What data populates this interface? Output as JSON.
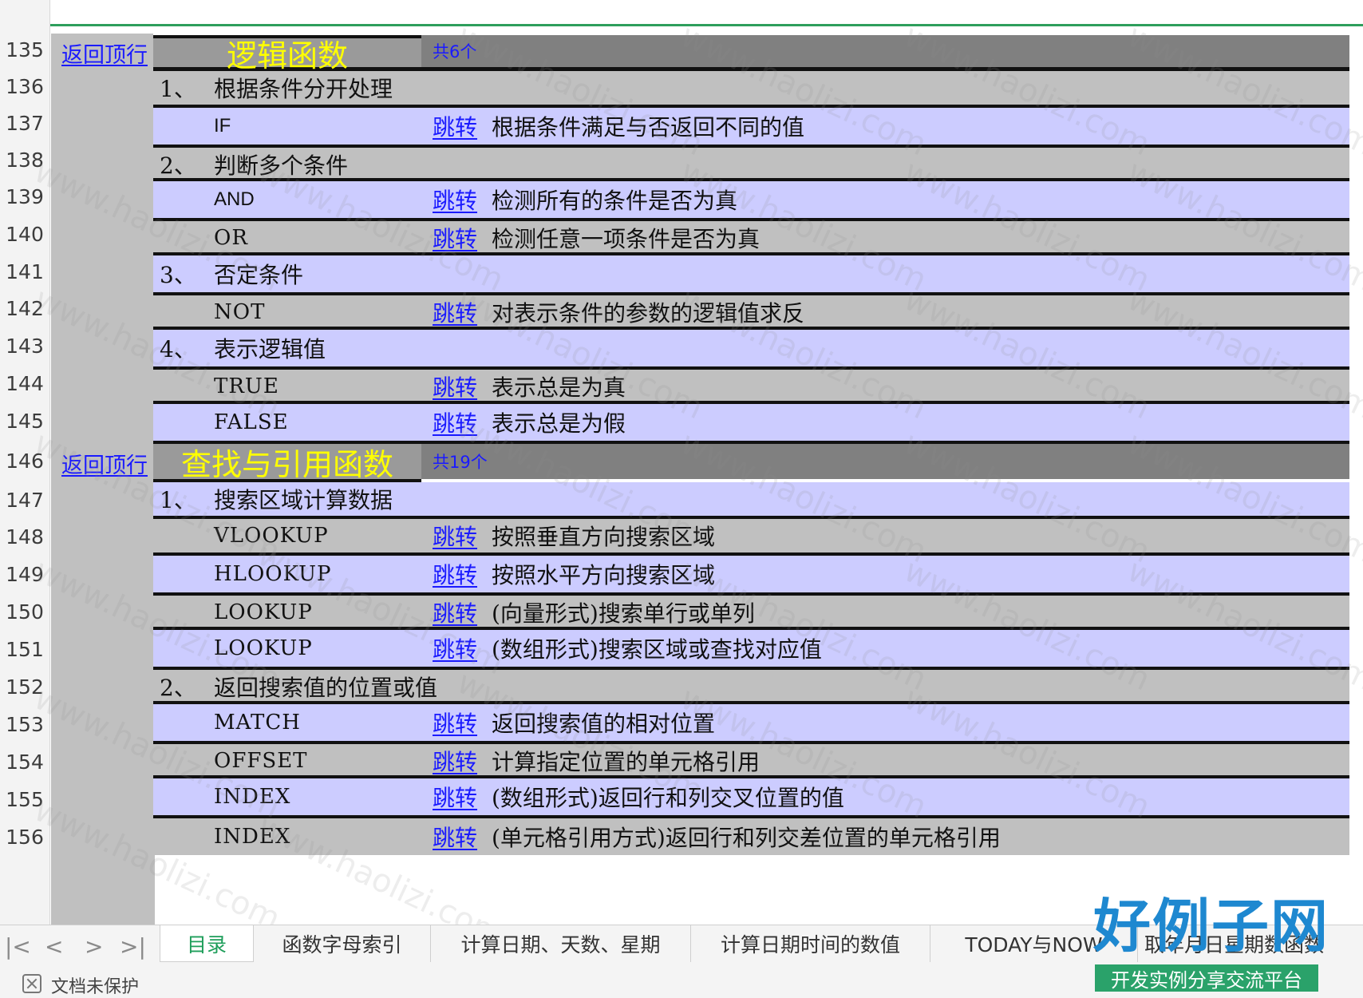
{
  "sheet": {
    "back_link": "返回顶行",
    "jump_label": "跳转",
    "row_numbers": [
      "135",
      "136",
      "137",
      "138",
      "139",
      "140",
      "141",
      "142",
      "143",
      "144",
      "145",
      "146",
      "147",
      "148",
      "149",
      "150",
      "151",
      "152",
      "153",
      "154",
      "155",
      "156"
    ],
    "section_logic": {
      "title": "逻辑函数",
      "count": "共6个"
    },
    "section_lookup": {
      "title": "查找与引用函数",
      "count": "共19个"
    },
    "rows": [
      {
        "num": "1、",
        "text": "根据条件分开处理"
      },
      {
        "fn": "IF",
        "desc": "根据条件满足与否返回不同的值"
      },
      {
        "num": "2、",
        "text": "判断多个条件"
      },
      {
        "fn": "AND",
        "desc": "检测所有的条件是否为真"
      },
      {
        "fn": "OR",
        "desc": "检测任意一项条件是否为真"
      },
      {
        "num": "3、",
        "text": "否定条件"
      },
      {
        "fn": "NOT",
        "desc": "对表示条件的参数的逻辑值求反"
      },
      {
        "num": "4、",
        "text": "表示逻辑值"
      },
      {
        "fn": "TRUE",
        "desc": "表示总是为真"
      },
      {
        "fn": "FALSE",
        "desc": "表示总是为假"
      },
      {
        "num": "1、",
        "text": "搜索区域计算数据"
      },
      {
        "fn": "VLOOKUP",
        "desc": "按照垂直方向搜索区域"
      },
      {
        "fn": "HLOOKUP",
        "desc": "按照水平方向搜索区域"
      },
      {
        "fn": "LOOKUP",
        "desc": "(向量形式)搜索单行或单列"
      },
      {
        "fn": "LOOKUP",
        "desc": "(数组形式)搜索区域或查找对应值"
      },
      {
        "num": "2、",
        "text": "返回搜索值的位置或值"
      },
      {
        "fn": "MATCH",
        "desc": "返回搜索值的相对位置"
      },
      {
        "fn": "OFFSET",
        "desc": "计算指定位置的单元格引用"
      },
      {
        "fn": "INDEX",
        "desc": "(数组形式)返回行和列交叉位置的值"
      },
      {
        "fn": "INDEX",
        "desc": "(单元格引用方式)返回行和列交差位置的单元格引用"
      }
    ]
  },
  "tabbar": {
    "nav": [
      "|<",
      "<",
      ">",
      ">|"
    ],
    "tabs": [
      "目录",
      "函数字母索引",
      "计算日期、天数、星期",
      "计算日期时间的数值",
      "TODAY与NOW",
      "取年月日星期数函数"
    ]
  },
  "status": {
    "text": "文档未保护"
  },
  "watermark": "www.haolizi.com",
  "logo": {
    "main": "好例子网",
    "sub": "开发实例分享交流平台"
  },
  "colors": {
    "row_gray": "#c0c0c0",
    "row_purple": "#ccccff",
    "header_gray": "#808080",
    "title_yellow": "#ffff00",
    "link_blue": "#1a1aff",
    "active_tab_green": "#1e9e5a"
  }
}
